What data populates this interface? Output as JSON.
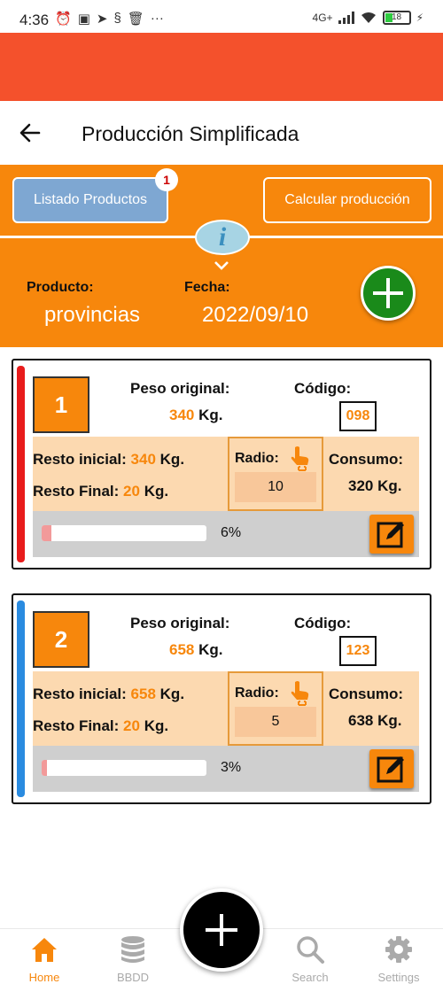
{
  "status_bar": {
    "time": "4:36",
    "network": "4G+",
    "battery": "18"
  },
  "header": {
    "title": "Producción Simplificada"
  },
  "toolbar": {
    "listado_label": "Listado Productos",
    "listado_badge": "1",
    "calcular_label": "Calcular producción",
    "info_glyph": "i"
  },
  "summary": {
    "producto_label": "Producto:",
    "producto_value": "provincias",
    "fecha_label": "Fecha:",
    "fecha_value": "2022/09/10"
  },
  "cards": [
    {
      "number": "1",
      "stripe_color": "#e81c1c",
      "peso_label": "Peso original:",
      "peso_value": "340",
      "peso_unit": "Kg.",
      "codigo_label": "Código:",
      "codigo_value": "098",
      "resto_inicial_label": "Resto inicial:",
      "resto_inicial_value": "340",
      "resto_inicial_unit": "Kg.",
      "resto_final_label": "Resto Final:",
      "resto_final_value": "20",
      "resto_final_unit": "Kg.",
      "radio_label": "Radio:",
      "radio_value": "10",
      "consumo_label": "Consumo:",
      "consumo_value": "320 Kg.",
      "progress": 0.06,
      "progress_text": "6%"
    },
    {
      "number": "2",
      "stripe_color": "#2a8be0",
      "peso_label": "Peso original:",
      "peso_value": "658",
      "peso_unit": "Kg.",
      "codigo_label": "Código:",
      "codigo_value": "123",
      "resto_inicial_label": "Resto inicial:",
      "resto_inicial_value": "658",
      "resto_inicial_unit": "Kg.",
      "resto_final_label": "Resto Final:",
      "resto_final_value": "20",
      "resto_final_unit": "Kg.",
      "radio_label": "Radio:",
      "radio_value": "5",
      "consumo_label": "Consumo:",
      "consumo_value": "638 Kg.",
      "progress": 0.03,
      "progress_text": "3%"
    }
  ],
  "nav": {
    "home": "Home",
    "bbdd": "BBDD",
    "search": "Search",
    "settings": "Settings"
  },
  "colors": {
    "accent": "#f7870c",
    "banner": "#f4512c",
    "add_green": "#1a8a1a"
  }
}
